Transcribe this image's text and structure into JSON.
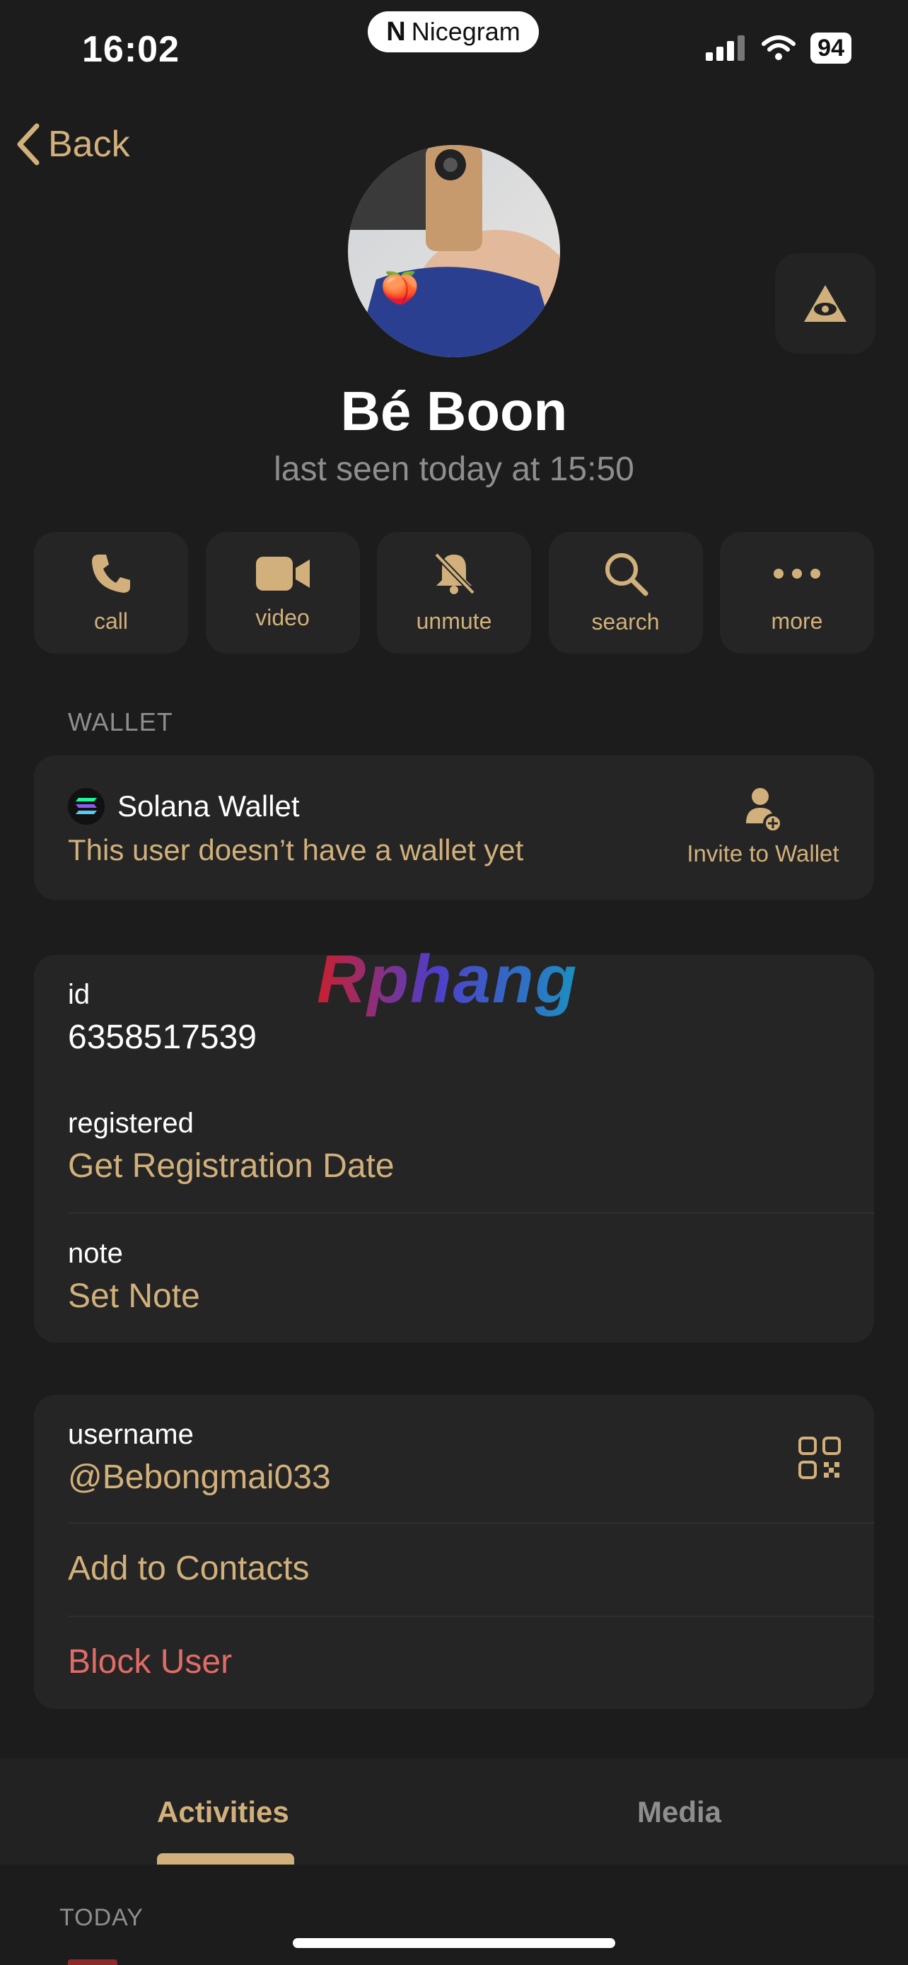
{
  "status_bar": {
    "time": "16:02",
    "app_pill": "Nicegram",
    "battery": "94"
  },
  "nav": {
    "back_label": "Back"
  },
  "profile": {
    "name": "Bé Boon",
    "last_seen": "last seen today at 15:50",
    "avatar_emoji": "🍑"
  },
  "actions": [
    {
      "label": "call",
      "icon": "phone-icon"
    },
    {
      "label": "video",
      "icon": "video-icon"
    },
    {
      "label": "unmute",
      "icon": "bell-slash-icon"
    },
    {
      "label": "search",
      "icon": "search-icon"
    },
    {
      "label": "more",
      "icon": "ellipsis-icon"
    }
  ],
  "wallet": {
    "section_label": "WALLET",
    "title": "Solana Wallet",
    "status": "This user doesn’t have a wallet yet",
    "invite_label": "Invite to Wallet"
  },
  "info": {
    "id_label": "id",
    "id_value": "6358517539",
    "registered_label": "registered",
    "registered_value": "Get Registration Date",
    "note_label": "note",
    "note_value": "Set Note"
  },
  "watermark": "Rphang",
  "contact": {
    "username_label": "username",
    "username_value": "@Bebongmai033",
    "add_contacts": "Add to Contacts",
    "block_user": "Block User"
  },
  "tabs": {
    "activities": "Activities",
    "media": "Media"
  },
  "feed": {
    "section_label": "TODAY"
  },
  "colors": {
    "accent": "#d1b07b",
    "danger": "#e06c65",
    "background": "#1c1c1c",
    "card": "#252525"
  }
}
